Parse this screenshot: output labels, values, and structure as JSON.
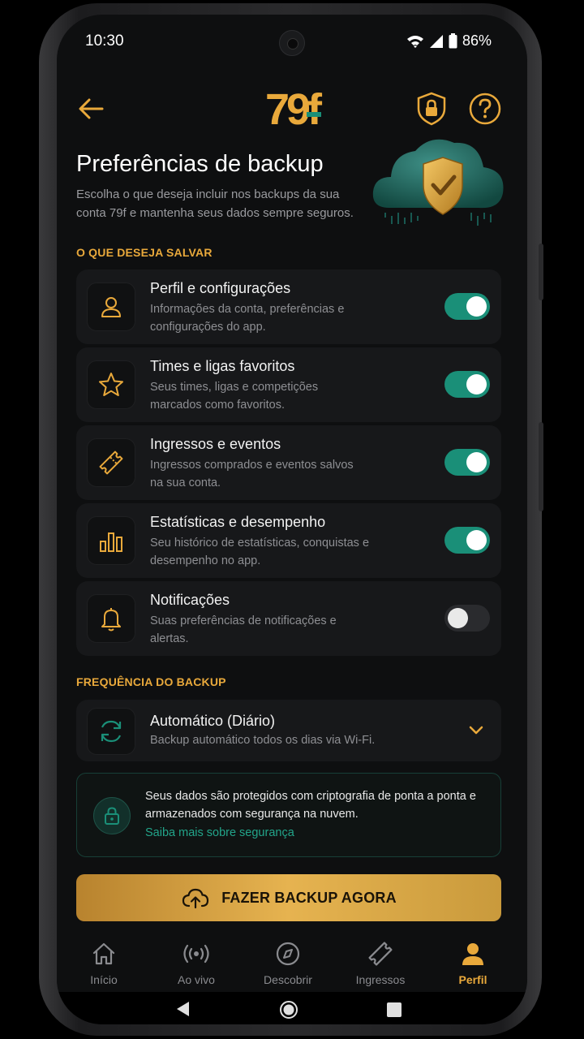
{
  "status_bar": {
    "time": "10:30",
    "battery": "86%"
  },
  "header": {
    "logo_text": "79f"
  },
  "page": {
    "title": "Preferências de backup",
    "subtitle": "Escolha o que deseja incluir nos backups da sua conta 79f e mantenha seus dados sempre seguros."
  },
  "section_save": {
    "label": "O QUE DESEJA SALVAR"
  },
  "items": [
    {
      "title": "Perfil e configurações",
      "desc": "Informações da conta, preferências e configurações do app.",
      "enabled": true,
      "icon": "user-icon"
    },
    {
      "title": "Times e ligas favoritos",
      "desc": "Seus times, ligas e competições marcados como favoritos.",
      "enabled": true,
      "icon": "star-icon"
    },
    {
      "title": "Ingressos e eventos",
      "desc": "Ingressos comprados e eventos salvos na sua conta.",
      "enabled": true,
      "icon": "ticket-icon"
    },
    {
      "title": "Estatísticas e desempenho",
      "desc": "Seu histórico de estatísticas, conquistas e desempenho no app.",
      "enabled": true,
      "icon": "bar-chart-icon"
    },
    {
      "title": "Notificações",
      "desc": "Suas preferências de notificações e alertas.",
      "enabled": false,
      "icon": "bell-icon"
    }
  ],
  "section_freq": {
    "label": "FREQUÊNCIA DO BACKUP"
  },
  "frequency": {
    "selected": "Automático (Diário)",
    "desc": "Backup automático todos os dias via Wi-Fi."
  },
  "security": {
    "text": "Seus dados são protegidos com criptografia de ponta a ponta e armazenados com segurança na nuvem.",
    "link": "Saiba mais sobre segurança"
  },
  "cta": {
    "label": "FAZER BACKUP AGORA"
  },
  "tabs": [
    {
      "label": "Início",
      "icon": "home-icon",
      "active": false
    },
    {
      "label": "Ao vivo",
      "icon": "live-icon",
      "active": false
    },
    {
      "label": "Descobrir",
      "icon": "compass-icon",
      "active": false
    },
    {
      "label": "Ingressos",
      "icon": "ticket-icon",
      "active": false
    },
    {
      "label": "Perfil",
      "icon": "profile-icon",
      "active": true
    }
  ],
  "colors": {
    "accent": "#e9a93b",
    "toggle_on": "#1a8f78",
    "teal": "#22a58a",
    "background": "#0e0f10"
  }
}
